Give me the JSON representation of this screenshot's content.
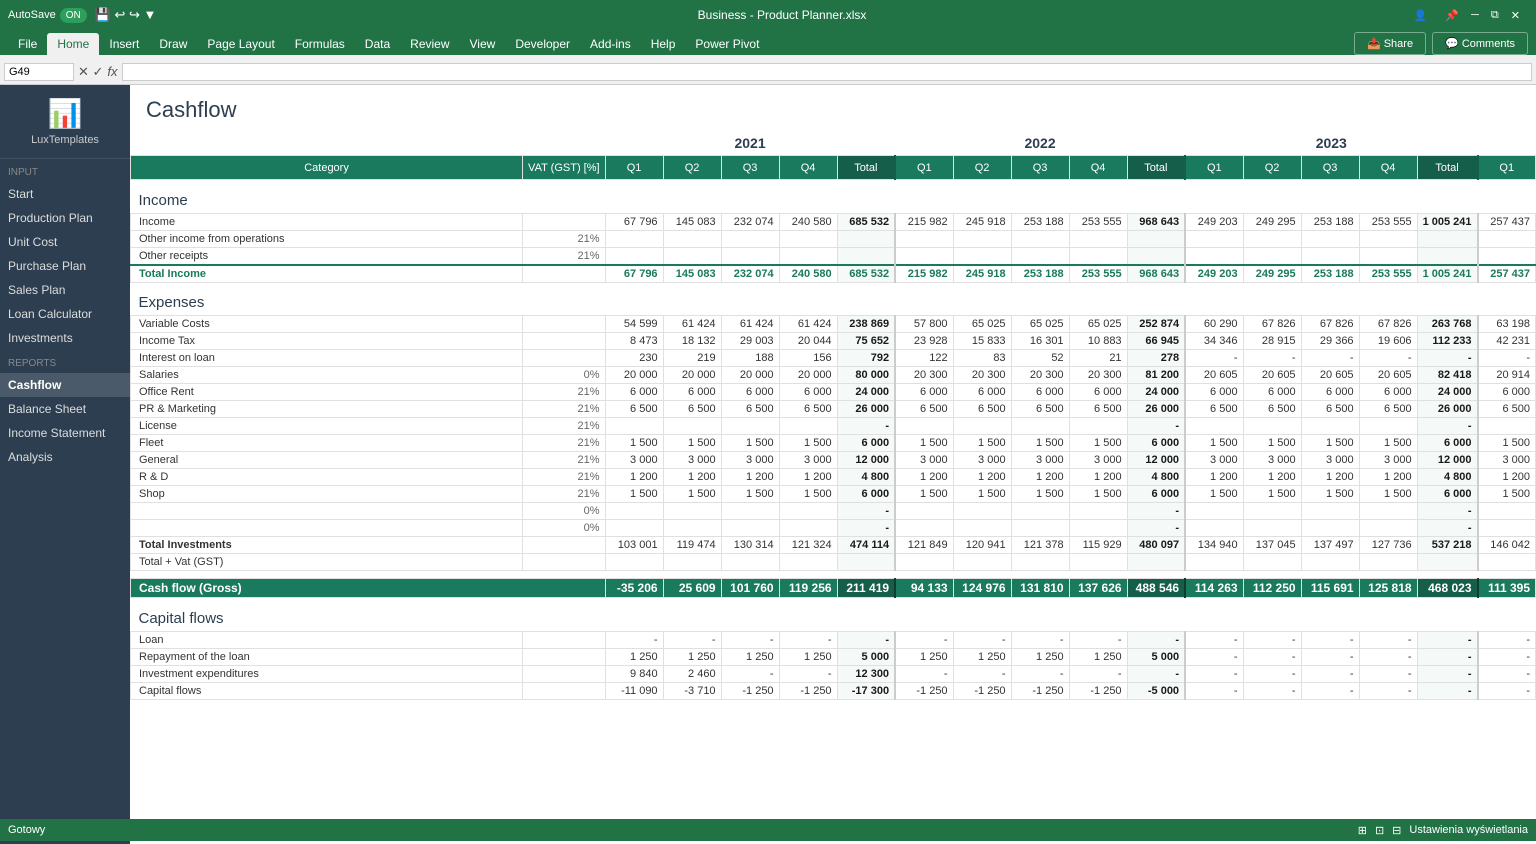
{
  "app": {
    "title": "Business - Product Planner.xlsx",
    "autosave_label": "AutoSave",
    "autosave_state": "ON",
    "cell_ref": "G49",
    "status": "Gotowy"
  },
  "ribbon": {
    "tabs": [
      "File",
      "Home",
      "Insert",
      "Draw",
      "Page Layout",
      "Formulas",
      "Data",
      "Review",
      "View",
      "Developer",
      "Add-ins",
      "Help",
      "Power Pivot"
    ],
    "active_tab": "Home",
    "share_label": "Share",
    "comments_label": "Comments"
  },
  "sidebar": {
    "logo_text": "LuxTemplates",
    "input_label": "Input",
    "input_items": [
      "Start",
      "Production Plan",
      "Unit Cost",
      "Purchase Plan",
      "Sales Plan",
      "Loan Calculator",
      "Investments"
    ],
    "reports_label": "Reports",
    "reports_items": [
      "Cashflow",
      "Balance Sheet",
      "Income Statement",
      "Analysis"
    ],
    "active_item": "Cashflow"
  },
  "sheet": {
    "title": "Cashflow",
    "col_headers": [
      "Category",
      "VAT (GST) [%]",
      "Q1",
      "Q2",
      "Q3",
      "Q4",
      "Total",
      "Q1",
      "Q2",
      "Q3",
      "Q4",
      "Total",
      "Q1",
      "Q2",
      "Q3",
      "Q4",
      "Total",
      "Q1"
    ],
    "years": [
      "2021",
      "2022",
      "2023"
    ],
    "income_section": "Income",
    "expenses_section": "Expenses",
    "capital_section": "Capital flows",
    "rows": {
      "income": [
        {
          "label": "Income",
          "vat": "",
          "q1": "67 796",
          "q2": "145 083",
          "q3": "232 074",
          "q4": "240 580",
          "total": "685 532",
          "q1b": "215 982",
          "q2b": "245 918",
          "q3b": "253 188",
          "q4b": "253 555",
          "totalb": "968 643",
          "q1c": "249 203",
          "q2c": "249 295",
          "q3c": "253 188",
          "q4c": "253 555",
          "totalc": "1 005 241",
          "q1d": "257 437"
        },
        {
          "label": "Other income from operations",
          "vat": "21%",
          "q1": "",
          "q2": "",
          "q3": "",
          "q4": "",
          "total": "",
          "q1b": "",
          "q2b": "",
          "q3b": "",
          "q4b": "",
          "totalb": "",
          "q1c": "",
          "q2c": "",
          "q3c": "",
          "q4c": "",
          "totalc": "",
          "q1d": ""
        },
        {
          "label": "Other receipts",
          "vat": "21%",
          "q1": "",
          "q2": "",
          "q3": "",
          "q4": "",
          "total": "",
          "q1b": "",
          "q2b": "",
          "q3b": "",
          "q4b": "",
          "totalb": "",
          "q1c": "",
          "q2c": "",
          "q3c": "",
          "q4c": "",
          "totalc": "",
          "q1d": ""
        }
      ],
      "total_income": {
        "label": "Total Income",
        "q1": "67 796",
        "q2": "145 083",
        "q3": "232 074",
        "q4": "240 580",
        "total": "685 532",
        "q1b": "215 982",
        "q2b": "245 918",
        "q3b": "253 188",
        "q4b": "253 555",
        "totalb": "968 643",
        "q1c": "249 203",
        "q2c": "249 295",
        "q3c": "253 188",
        "q4c": "253 555",
        "totalc": "1 005 241",
        "q1d": "257 437"
      },
      "expenses": [
        {
          "label": "Variable Costs",
          "vat": "",
          "q1": "54 599",
          "q2": "61 424",
          "q3": "61 424",
          "q4": "61 424",
          "total": "238 869",
          "q1b": "57 800",
          "q2b": "65 025",
          "q3b": "65 025",
          "q4b": "65 025",
          "totalb": "252 874",
          "q1c": "60 290",
          "q2c": "67 826",
          "q3c": "67 826",
          "q4c": "67 826",
          "totalc": "263 768",
          "q1d": "63 198"
        },
        {
          "label": "Income Tax",
          "vat": "",
          "q1": "8 473",
          "q2": "18 132",
          "q3": "29 003",
          "q4": "20 044",
          "total": "75 652",
          "q1b": "23 928",
          "q2b": "15 833",
          "q3b": "16 301",
          "q4b": "10 883",
          "totalb": "66 945",
          "q1c": "34 346",
          "q2c": "28 915",
          "q3c": "29 366",
          "q4c": "19 606",
          "totalc": "112 233",
          "q1d": "42 231"
        },
        {
          "label": "Interest on loan",
          "vat": "",
          "q1": "230",
          "q2": "219",
          "q3": "188",
          "q4": "156",
          "total": "792",
          "q1b": "122",
          "q2b": "83",
          "q3b": "52",
          "q4b": "21",
          "totalb": "278",
          "q1c": "-",
          "q2c": "-",
          "q3c": "-",
          "q4c": "-",
          "totalc": "-",
          "q1d": "-"
        },
        {
          "label": "Salaries",
          "vat": "0%",
          "q1": "20 000",
          "q2": "20 000",
          "q3": "20 000",
          "q4": "20 000",
          "total": "80 000",
          "q1b": "20 300",
          "q2b": "20 300",
          "q3b": "20 300",
          "q4b": "20 300",
          "totalb": "81 200",
          "q1c": "20 605",
          "q2c": "20 605",
          "q3c": "20 605",
          "q4c": "20 605",
          "totalc": "82 418",
          "q1d": "20 914"
        },
        {
          "label": "Office Rent",
          "vat": "21%",
          "q1": "6 000",
          "q2": "6 000",
          "q3": "6 000",
          "q4": "6 000",
          "total": "24 000",
          "q1b": "6 000",
          "q2b": "6 000",
          "q3b": "6 000",
          "q4b": "6 000",
          "totalb": "24 000",
          "q1c": "6 000",
          "q2c": "6 000",
          "q3c": "6 000",
          "q4c": "6 000",
          "totalc": "24 000",
          "q1d": "6 000"
        },
        {
          "label": "PR & Marketing",
          "vat": "21%",
          "q1": "6 500",
          "q2": "6 500",
          "q3": "6 500",
          "q4": "6 500",
          "total": "26 000",
          "q1b": "6 500",
          "q2b": "6 500",
          "q3b": "6 500",
          "q4b": "6 500",
          "totalb": "26 000",
          "q1c": "6 500",
          "q2c": "6 500",
          "q3c": "6 500",
          "q4c": "6 500",
          "totalc": "26 000",
          "q1d": "6 500"
        },
        {
          "label": "License",
          "vat": "21%",
          "q1": "",
          "q2": "",
          "q3": "",
          "q4": "",
          "total": "-",
          "q1b": "",
          "q2b": "",
          "q3b": "",
          "q4b": "",
          "totalb": "-",
          "q1c": "",
          "q2c": "",
          "q3c": "",
          "q4c": "",
          "totalc": "-",
          "q1d": ""
        },
        {
          "label": "Fleet",
          "vat": "21%",
          "q1": "1 500",
          "q2": "1 500",
          "q3": "1 500",
          "q4": "1 500",
          "total": "6 000",
          "q1b": "1 500",
          "q2b": "1 500",
          "q3b": "1 500",
          "q4b": "1 500",
          "totalb": "6 000",
          "q1c": "1 500",
          "q2c": "1 500",
          "q3c": "1 500",
          "q4c": "1 500",
          "totalc": "6 000",
          "q1d": "1 500"
        },
        {
          "label": "General",
          "vat": "21%",
          "q1": "3 000",
          "q2": "3 000",
          "q3": "3 000",
          "q4": "3 000",
          "total": "12 000",
          "q1b": "3 000",
          "q2b": "3 000",
          "q3b": "3 000",
          "q4b": "3 000",
          "totalb": "12 000",
          "q1c": "3 000",
          "q2c": "3 000",
          "q3c": "3 000",
          "q4c": "3 000",
          "totalc": "12 000",
          "q1d": "3 000"
        },
        {
          "label": "R & D",
          "vat": "21%",
          "q1": "1 200",
          "q2": "1 200",
          "q3": "1 200",
          "q4": "1 200",
          "total": "4 800",
          "q1b": "1 200",
          "q2b": "1 200",
          "q3b": "1 200",
          "q4b": "1 200",
          "totalb": "4 800",
          "q1c": "1 200",
          "q2c": "1 200",
          "q3c": "1 200",
          "q4c": "1 200",
          "totalc": "4 800",
          "q1d": "1 200"
        },
        {
          "label": "Shop",
          "vat": "21%",
          "q1": "1 500",
          "q2": "1 500",
          "q3": "1 500",
          "q4": "1 500",
          "total": "6 000",
          "q1b": "1 500",
          "q2b": "1 500",
          "q3b": "1 500",
          "q4b": "1 500",
          "totalb": "6 000",
          "q1c": "1 500",
          "q2c": "1 500",
          "q3c": "1 500",
          "q4c": "1 500",
          "totalc": "6 000",
          "q1d": "1 500"
        },
        {
          "label": "",
          "vat": "0%",
          "q1": "",
          "q2": "",
          "q3": "",
          "q4": "",
          "total": "-",
          "q1b": "",
          "q2b": "",
          "q3b": "",
          "q4b": "",
          "totalb": "-",
          "q1c": "",
          "q2c": "",
          "q3c": "",
          "q4c": "",
          "totalc": "-",
          "q1d": ""
        },
        {
          "label": "",
          "vat": "0%",
          "q1": "",
          "q2": "",
          "q3": "",
          "q4": "",
          "total": "-",
          "q1b": "",
          "q2b": "",
          "q3b": "",
          "q4b": "",
          "totalb": "-",
          "q1c": "",
          "q2c": "",
          "q3c": "",
          "q4c": "",
          "totalc": "-",
          "q1d": ""
        }
      ],
      "total_investments": {
        "label": "Total Investments",
        "q1": "103 001",
        "q2": "119 474",
        "q3": "130 314",
        "q4": "121 324",
        "total": "474 114",
        "q1b": "121 849",
        "q2b": "120 941",
        "q3b": "121 378",
        "q4b": "115 929",
        "totalb": "480 097",
        "q1c": "134 940",
        "q2c": "137 045",
        "q3c": "137 497",
        "q4c": "127 736",
        "totalc": "537 218",
        "q1d": "146 042"
      },
      "total_vat": {
        "label": "Total + Vat (GST)"
      },
      "cashflow_gross": {
        "label": "Cash flow (Gross)",
        "q1": "-35 206",
        "q2": "25 609",
        "q3": "101 760",
        "q4": "119 256",
        "total": "211 419",
        "q1b": "94 133",
        "q2b": "124 976",
        "q3b": "131 810",
        "q4b": "137 626",
        "totalb": "488 546",
        "q1c": "114 263",
        "q2c": "112 250",
        "q3c": "115 691",
        "q4c": "125 818",
        "totalc": "468 023",
        "q1d": "111 395"
      },
      "capital_rows": [
        {
          "label": "Loan",
          "vat": "",
          "q1": "-",
          "q2": "-",
          "q3": "-",
          "q4": "-",
          "total": "-",
          "q1b": "-",
          "q2b": "-",
          "q3b": "-",
          "q4b": "-",
          "totalb": "-",
          "q1c": "-",
          "q2c": "-",
          "q3c": "-",
          "q4c": "-",
          "totalc": "-",
          "q1d": "-"
        },
        {
          "label": "Repayment of the loan",
          "vat": "",
          "q1": "1 250",
          "q2": "1 250",
          "q3": "1 250",
          "q4": "1 250",
          "total": "5 000",
          "q1b": "1 250",
          "q2b": "1 250",
          "q3b": "1 250",
          "q4b": "1 250",
          "totalb": "5 000",
          "q1c": "-",
          "q2c": "-",
          "q3c": "-",
          "q4c": "-",
          "totalc": "-",
          "q1d": "-"
        },
        {
          "label": "Investment expenditures",
          "vat": "",
          "q1": "9 840",
          "q2": "2 460",
          "q3": "-",
          "q4": "-",
          "total": "12 300",
          "q1b": "-",
          "q2b": "-",
          "q3b": "-",
          "q4b": "-",
          "totalb": "-",
          "q1c": "-",
          "q2c": "-",
          "q3c": "-",
          "q4c": "-",
          "totalc": "-",
          "q1d": "-"
        },
        {
          "label": "Capital flows",
          "vat": "",
          "q1": "-11 090",
          "q2": "-3 710",
          "q3": "-1 250",
          "q4": "-1 250",
          "total": "-17 300",
          "q1b": "-1 250",
          "q2b": "-1 250",
          "q3b": "-1 250",
          "q4b": "-1 250",
          "totalb": "-5 000",
          "q1c": "-",
          "q2c": "-",
          "q3c": "-",
          "q4c": "-",
          "totalc": "-",
          "q1d": "-"
        }
      ]
    }
  }
}
